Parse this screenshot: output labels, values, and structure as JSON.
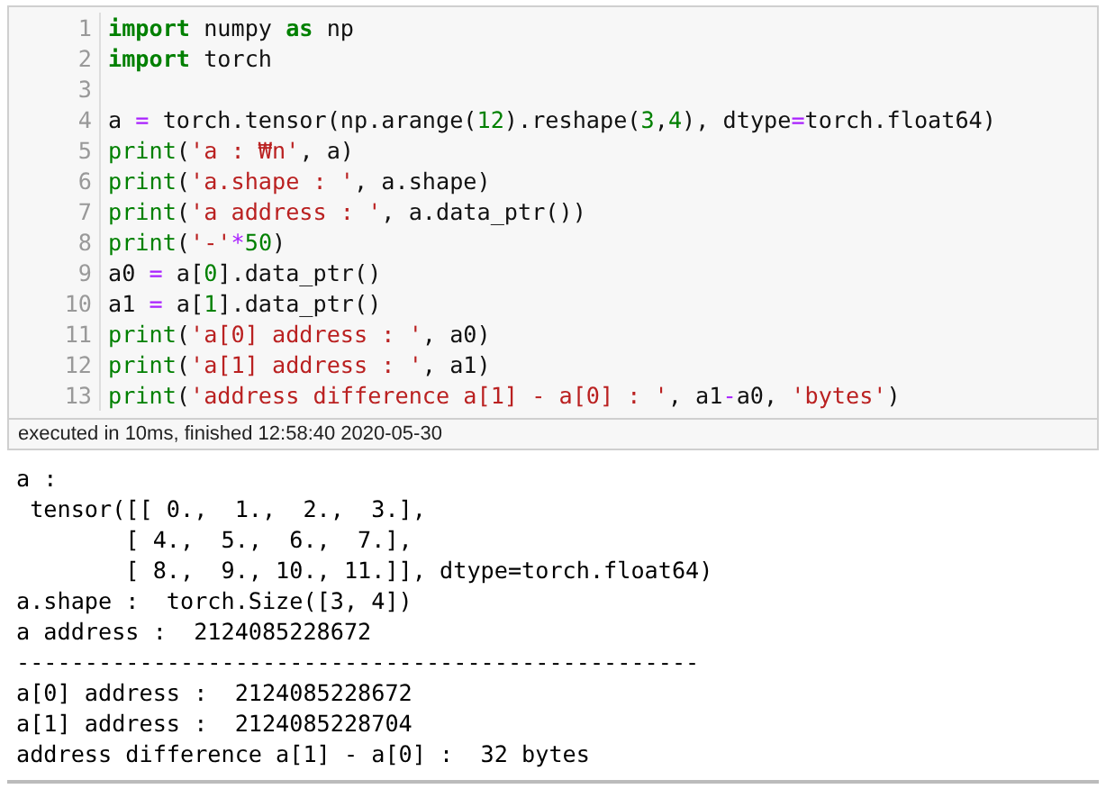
{
  "cell": {
    "code_lines": [
      {
        "number": "1",
        "tokens": [
          {
            "kind": "kw",
            "text": "import"
          },
          {
            "kind": "plain",
            "text": " numpy "
          },
          {
            "kind": "kw",
            "text": "as"
          },
          {
            "kind": "plain",
            "text": " np"
          }
        ]
      },
      {
        "number": "2",
        "tokens": [
          {
            "kind": "kw",
            "text": "import"
          },
          {
            "kind": "plain",
            "text": " torch"
          }
        ]
      },
      {
        "number": "3"
      },
      {
        "number": "4",
        "tokens": [
          {
            "kind": "plain",
            "text": "a "
          },
          {
            "kind": "op",
            "text": "="
          },
          {
            "kind": "plain",
            "text": " torch.tensor(np.arange("
          },
          {
            "kind": "num",
            "text": "12"
          },
          {
            "kind": "plain",
            "text": ").reshape("
          },
          {
            "kind": "num",
            "text": "3"
          },
          {
            "kind": "plain",
            "text": ","
          },
          {
            "kind": "num",
            "text": "4"
          },
          {
            "kind": "plain",
            "text": "), dtype"
          },
          {
            "kind": "op",
            "text": "="
          },
          {
            "kind": "plain",
            "text": "torch.float64)"
          }
        ]
      },
      {
        "number": "5",
        "tokens": [
          {
            "kind": "builtin",
            "text": "print"
          },
          {
            "kind": "plain",
            "text": "("
          },
          {
            "kind": "str",
            "text": "'a : ₩n'"
          },
          {
            "kind": "plain",
            "text": ", a)"
          }
        ]
      },
      {
        "number": "6",
        "tokens": [
          {
            "kind": "builtin",
            "text": "print"
          },
          {
            "kind": "plain",
            "text": "("
          },
          {
            "kind": "str",
            "text": "'a.shape : '"
          },
          {
            "kind": "plain",
            "text": ", a.shape)"
          }
        ]
      },
      {
        "number": "7",
        "tokens": [
          {
            "kind": "builtin",
            "text": "print"
          },
          {
            "kind": "plain",
            "text": "("
          },
          {
            "kind": "str",
            "text": "'a address : '"
          },
          {
            "kind": "plain",
            "text": ", a.data_ptr())"
          }
        ]
      },
      {
        "number": "8",
        "tokens": [
          {
            "kind": "builtin",
            "text": "print"
          },
          {
            "kind": "plain",
            "text": "("
          },
          {
            "kind": "str",
            "text": "'-'"
          },
          {
            "kind": "op",
            "text": "*"
          },
          {
            "kind": "num",
            "text": "50"
          },
          {
            "kind": "plain",
            "text": ")"
          }
        ]
      },
      {
        "number": "9",
        "tokens": [
          {
            "kind": "plain",
            "text": "a0 "
          },
          {
            "kind": "op",
            "text": "="
          },
          {
            "kind": "plain",
            "text": " a["
          },
          {
            "kind": "num",
            "text": "0"
          },
          {
            "kind": "plain",
            "text": "].data_ptr()"
          }
        ]
      },
      {
        "number": "10",
        "tokens": [
          {
            "kind": "plain",
            "text": "a1 "
          },
          {
            "kind": "op",
            "text": "="
          },
          {
            "kind": "plain",
            "text": " a["
          },
          {
            "kind": "num",
            "text": "1"
          },
          {
            "kind": "plain",
            "text": "].data_ptr()"
          }
        ]
      },
      {
        "number": "11",
        "tokens": [
          {
            "kind": "builtin",
            "text": "print"
          },
          {
            "kind": "plain",
            "text": "("
          },
          {
            "kind": "str",
            "text": "'a[0] address : '"
          },
          {
            "kind": "plain",
            "text": ", a0)"
          }
        ]
      },
      {
        "number": "12",
        "tokens": [
          {
            "kind": "builtin",
            "text": "print"
          },
          {
            "kind": "plain",
            "text": "("
          },
          {
            "kind": "str",
            "text": "'a[1] address : '"
          },
          {
            "kind": "plain",
            "text": ", a1)"
          }
        ]
      },
      {
        "number": "13",
        "tokens": [
          {
            "kind": "builtin",
            "text": "print"
          },
          {
            "kind": "plain",
            "text": "("
          },
          {
            "kind": "str",
            "text": "'address difference a[1] - a[0] : '"
          },
          {
            "kind": "plain",
            "text": ", a1"
          },
          {
            "kind": "op",
            "text": "-"
          },
          {
            "kind": "plain",
            "text": "a0, "
          },
          {
            "kind": "str",
            "text": "'bytes'"
          },
          {
            "kind": "plain",
            "text": ")"
          }
        ]
      }
    ],
    "status": "executed in 10ms, finished 12:58:40 2020-05-30",
    "output_lines": [
      "a : ",
      " tensor([[ 0.,  1.,  2.,  3.],",
      "        [ 4.,  5.,  6.,  7.],",
      "        [ 8.,  9., 10., 11.]], dtype=torch.float64)",
      "a.shape :  torch.Size([3, 4])",
      "a address :  2124085228672",
      "--------------------------------------------------",
      "a[0] address :  2124085228672",
      "a[1] address :  2124085228704",
      "address difference a[1] - a[0] :  32 bytes"
    ]
  }
}
